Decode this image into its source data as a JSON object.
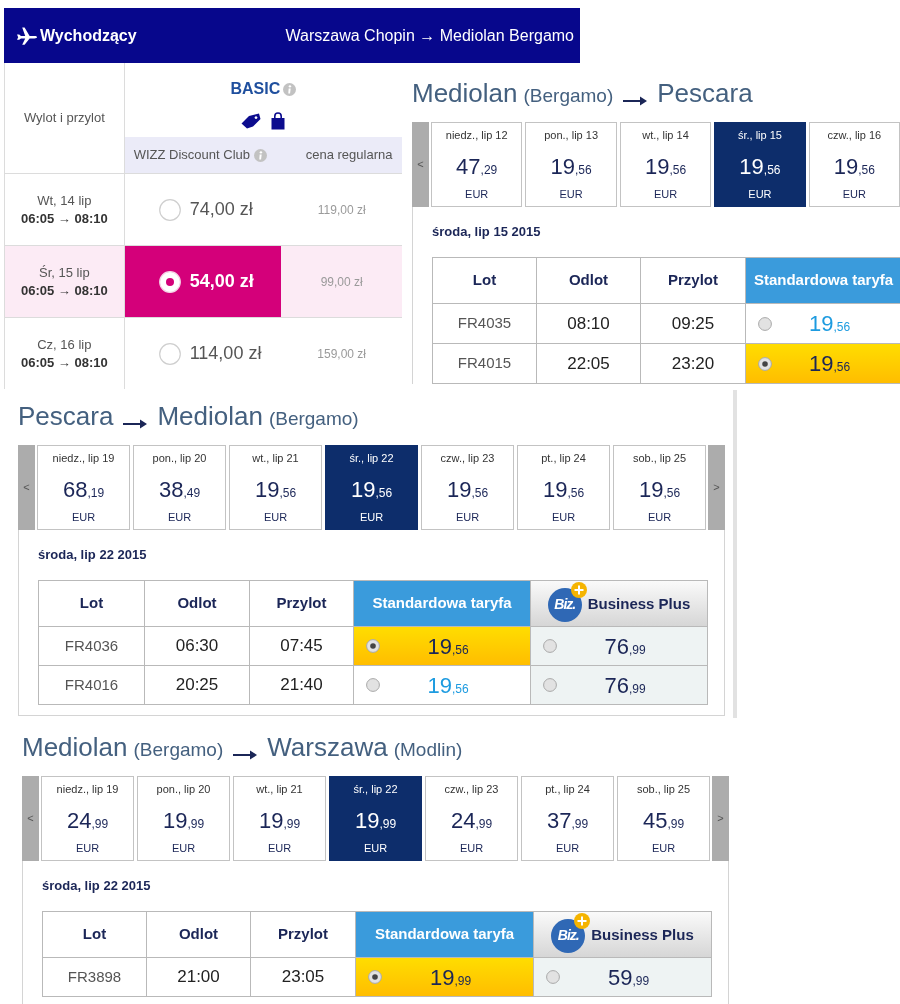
{
  "outbound": {
    "header": {
      "title": "Wychodzący",
      "route": "Warszawa Chopin → Mediolan Bergamo"
    },
    "schedule_header": "Wylot i przylot",
    "fare": {
      "name": "BASIC",
      "member_label": "WIZZ Discount Club",
      "regular_label": "cena regularna"
    },
    "rows": [
      {
        "date": "Wt, 14 lip",
        "times": "06:05 → 08:10",
        "member_price": "74,00 zł",
        "regular_price": "119,00 zł",
        "selected": false
      },
      {
        "date": "Śr, 15 lip",
        "times": "06:05 → 08:10",
        "member_price": "54,00 zł",
        "regular_price": "99,00 zł",
        "selected": true
      },
      {
        "date": "Cz, 16 lip",
        "times": "06:05 → 08:10",
        "member_price": "114,00 zł",
        "regular_price": "159,00 zł",
        "selected": false
      }
    ]
  },
  "route_panels": [
    {
      "title": {
        "from_city": "Mediolan",
        "from_airport": "(Bergamo)",
        "to_city": "Pescara"
      },
      "nav": {
        "prev": "<"
      },
      "dates": [
        {
          "label": "niedz., lip 12",
          "amount": "47",
          "decimals": ",29",
          "currency": "EUR",
          "selected": false
        },
        {
          "label": "pon., lip 13",
          "amount": "19",
          "decimals": ",56",
          "currency": "EUR",
          "selected": false
        },
        {
          "label": "wt., lip 14",
          "amount": "19",
          "decimals": ",56",
          "currency": "EUR",
          "selected": false
        },
        {
          "label": "śr., lip 15",
          "amount": "19",
          "decimals": ",56",
          "currency": "EUR",
          "selected": true
        },
        {
          "label": "czw., lip 16",
          "amount": "19",
          "decimals": ",56",
          "currency": "EUR",
          "selected": false
        }
      ],
      "day": "środa, lip 15 2015",
      "columns": [
        "Lot",
        "Odlot",
        "Przylot"
      ],
      "fares": [
        {
          "kind": "standard",
          "label": "Standardowa taryfa"
        }
      ],
      "rows": [
        {
          "flight": "FR4035",
          "departure": "08:10",
          "arrival": "09:25",
          "prices": [
            {
              "amount": "19",
              "decimals": ",56",
              "selected": false
            }
          ]
        },
        {
          "flight": "FR4015",
          "departure": "22:05",
          "arrival": "23:20",
          "prices": [
            {
              "amount": "19",
              "decimals": ",56",
              "selected": true
            }
          ]
        }
      ]
    },
    {
      "title": {
        "from_city": "Pescara",
        "to_city": "Mediolan",
        "to_airport": "(Bergamo)"
      },
      "nav": {
        "prev": "<",
        "next": ">"
      },
      "dates": [
        {
          "label": "niedz., lip 19",
          "amount": "68",
          "decimals": ",19",
          "currency": "EUR",
          "selected": false
        },
        {
          "label": "pon., lip 20",
          "amount": "38",
          "decimals": ",49",
          "currency": "EUR",
          "selected": false
        },
        {
          "label": "wt., lip 21",
          "amount": "19",
          "decimals": ",56",
          "currency": "EUR",
          "selected": false
        },
        {
          "label": "śr., lip 22",
          "amount": "19",
          "decimals": ",56",
          "currency": "EUR",
          "selected": true
        },
        {
          "label": "czw., lip 23",
          "amount": "19",
          "decimals": ",56",
          "currency": "EUR",
          "selected": false
        },
        {
          "label": "pt., lip 24",
          "amount": "19",
          "decimals": ",56",
          "currency": "EUR",
          "selected": false
        },
        {
          "label": "sob., lip 25",
          "amount": "19",
          "decimals": ",56",
          "currency": "EUR",
          "selected": false
        }
      ],
      "day": "środa, lip 22 2015",
      "columns": [
        "Lot",
        "Odlot",
        "Przylot"
      ],
      "fares": [
        {
          "kind": "standard",
          "label": "Standardowa taryfa"
        },
        {
          "kind": "business",
          "label": "Business Plus",
          "logo": "Biz."
        }
      ],
      "rows": [
        {
          "flight": "FR4036",
          "departure": "06:30",
          "arrival": "07:45",
          "prices": [
            {
              "amount": "19",
              "decimals": ",56",
              "selected": true
            },
            {
              "amount": "76",
              "decimals": ",99",
              "selected": false
            }
          ]
        },
        {
          "flight": "FR4016",
          "departure": "20:25",
          "arrival": "21:40",
          "prices": [
            {
              "amount": "19",
              "decimals": ",56",
              "selected": false
            },
            {
              "amount": "76",
              "decimals": ",99",
              "selected": false
            }
          ]
        }
      ]
    },
    {
      "title": {
        "from_city": "Mediolan",
        "from_airport": "(Bergamo)",
        "to_city": "Warszawa",
        "to_airport": "(Modlin)"
      },
      "nav": {
        "prev": "<",
        "next": ">"
      },
      "dates": [
        {
          "label": "niedz., lip 19",
          "amount": "24",
          "decimals": ",99",
          "currency": "EUR",
          "selected": false
        },
        {
          "label": "pon., lip 20",
          "amount": "19",
          "decimals": ",99",
          "currency": "EUR",
          "selected": false
        },
        {
          "label": "wt., lip 21",
          "amount": "19",
          "decimals": ",99",
          "currency": "EUR",
          "selected": false
        },
        {
          "label": "śr., lip 22",
          "amount": "19",
          "decimals": ",99",
          "currency": "EUR",
          "selected": true
        },
        {
          "label": "czw., lip 23",
          "amount": "24",
          "decimals": ",99",
          "currency": "EUR",
          "selected": false
        },
        {
          "label": "pt., lip 24",
          "amount": "37",
          "decimals": ",99",
          "currency": "EUR",
          "selected": false
        },
        {
          "label": "sob., lip 25",
          "amount": "45",
          "decimals": ",99",
          "currency": "EUR",
          "selected": false
        }
      ],
      "day": "środa, lip 22 2015",
      "columns": [
        "Lot",
        "Odlot",
        "Przylot"
      ],
      "fares": [
        {
          "kind": "standard",
          "label": "Standardowa taryfa"
        },
        {
          "kind": "business",
          "label": "Business Plus",
          "logo": "Biz."
        }
      ],
      "rows": [
        {
          "flight": "FR3898",
          "departure": "21:00",
          "arrival": "23:05",
          "prices": [
            {
              "amount": "19",
              "decimals": ",99",
              "selected": true
            },
            {
              "amount": "59",
              "decimals": ",99",
              "selected": false
            }
          ]
        }
      ]
    }
  ]
}
